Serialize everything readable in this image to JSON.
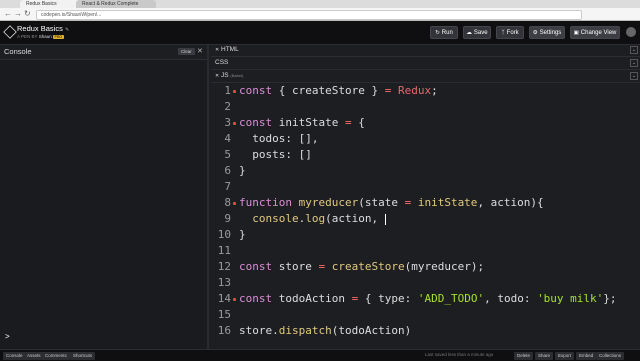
{
  "browser": {
    "tabs": [
      "Redux Basics",
      "React & Redux Complete"
    ],
    "url": "codepen.io/ShaunW/pen/..."
  },
  "header": {
    "title": "Redux Basics",
    "edit_icon": "pencil-icon",
    "author_prefix": "A PEN BY",
    "author": "Shaun",
    "badge": "PRO",
    "buttons": {
      "run": "Run",
      "save": "Save",
      "fork": "Fork",
      "settings": "Settings",
      "change_view": "Change View"
    }
  },
  "console": {
    "title": "Console",
    "clear_label": "Clear",
    "prompt": ">"
  },
  "editors": {
    "html_label": "HTML",
    "css_label": "CSS",
    "js_label": "JS",
    "js_sub": "(Babel)"
  },
  "code": [
    {
      "n": "1",
      "fold": true,
      "tokens": [
        [
          "kw",
          "const "
        ],
        [
          "var",
          "{ createStore } "
        ],
        [
          "op",
          "= "
        ],
        [
          "cls",
          "Redux"
        ],
        [
          "var",
          ";"
        ]
      ]
    },
    {
      "n": "2",
      "fold": false,
      "tokens": []
    },
    {
      "n": "3",
      "fold": true,
      "tokens": [
        [
          "kw",
          "const "
        ],
        [
          "var",
          "initState "
        ],
        [
          "op",
          "= "
        ],
        [
          "var",
          "{"
        ]
      ]
    },
    {
      "n": "4",
      "fold": false,
      "tokens": [
        [
          "var",
          "  todos: [],"
        ]
      ]
    },
    {
      "n": "5",
      "fold": false,
      "tokens": [
        [
          "var",
          "  posts: []"
        ]
      ]
    },
    {
      "n": "6",
      "fold": false,
      "tokens": [
        [
          "var",
          "}"
        ]
      ]
    },
    {
      "n": "7",
      "fold": false,
      "tokens": []
    },
    {
      "n": "8",
      "fold": true,
      "tokens": [
        [
          "kw",
          "function "
        ],
        [
          "fn",
          "myreducer"
        ],
        [
          "var",
          "(state "
        ],
        [
          "op",
          "= "
        ],
        [
          "fn",
          "initState"
        ],
        [
          "var",
          ", action){"
        ]
      ]
    },
    {
      "n": "9",
      "fold": false,
      "tokens": [
        [
          "var",
          "  "
        ],
        [
          "fn",
          "console"
        ],
        [
          "var",
          "."
        ],
        [
          "fn",
          "log"
        ],
        [
          "var",
          "(action, "
        ]
      ],
      "cursor": true
    },
    {
      "n": "10",
      "fold": false,
      "tokens": [
        [
          "var",
          "}"
        ]
      ]
    },
    {
      "n": "11",
      "fold": false,
      "tokens": []
    },
    {
      "n": "12",
      "fold": false,
      "tokens": [
        [
          "kw",
          "const "
        ],
        [
          "var",
          "store "
        ],
        [
          "op",
          "= "
        ],
        [
          "fn",
          "createStore"
        ],
        [
          "var",
          "(myreducer);"
        ]
      ]
    },
    {
      "n": "13",
      "fold": false,
      "tokens": []
    },
    {
      "n": "14",
      "fold": true,
      "tokens": [
        [
          "kw",
          "const "
        ],
        [
          "var",
          "todoAction "
        ],
        [
          "op",
          "= "
        ],
        [
          "var",
          "{ type: "
        ],
        [
          "str",
          "'ADD_TODO'"
        ],
        [
          "var",
          ", todo: "
        ],
        [
          "str",
          "'buy milk'"
        ],
        [
          "var",
          "};"
        ]
      ]
    },
    {
      "n": "15",
      "fold": false,
      "tokens": []
    },
    {
      "n": "16",
      "fold": false,
      "tokens": [
        [
          "var",
          "store."
        ],
        [
          "fn",
          "dispatch"
        ],
        [
          "var",
          "(todoAction)"
        ]
      ]
    }
  ],
  "footer": {
    "left_buttons": [
      "Console",
      "Assets",
      "Comments",
      "Shortcuts"
    ],
    "status": "Last saved less than a minute ago",
    "right_buttons": [
      "Delete",
      "Share",
      "Export",
      "Embed",
      "Collections"
    ]
  }
}
